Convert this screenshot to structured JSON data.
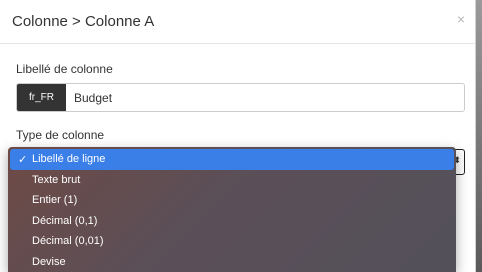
{
  "modal": {
    "title": "Colonne > Colonne A",
    "close_label": "×"
  },
  "label_field": {
    "label": "Libellé de colonne",
    "lang": "fr_FR",
    "value": "Budget"
  },
  "type_field": {
    "label": "Type de colonne",
    "arrow": "⬍"
  },
  "dropdown": {
    "options": [
      {
        "label": "Libellé de ligne",
        "selected": true
      },
      {
        "label": "Texte brut",
        "selected": false
      },
      {
        "label": "Entier (1)",
        "selected": false
      },
      {
        "label": "Décimal (0,1)",
        "selected": false
      },
      {
        "label": "Décimal (0,01)",
        "selected": false
      },
      {
        "label": "Devise",
        "selected": false
      }
    ],
    "check_glyph": "✓"
  },
  "colors": {
    "selected_bg": "#3a7ee8",
    "lang_addon_bg": "#333333"
  }
}
